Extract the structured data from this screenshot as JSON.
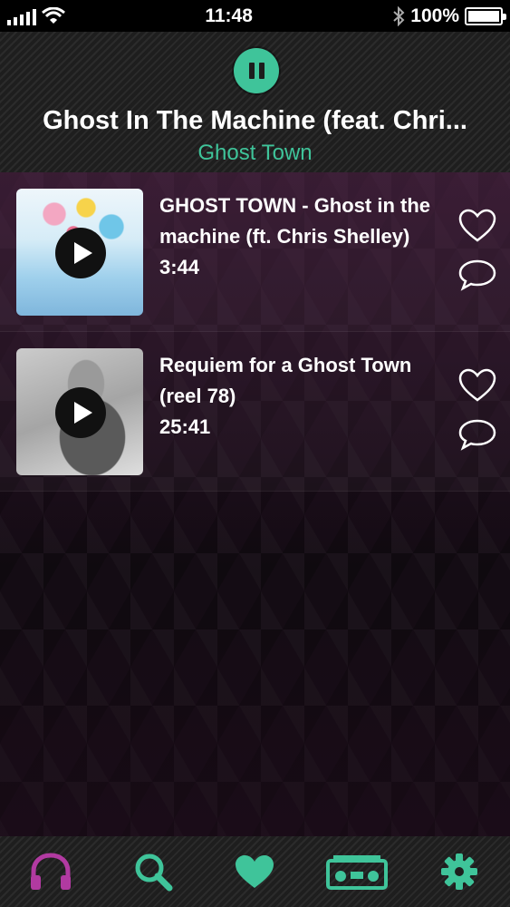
{
  "status_bar": {
    "time": "11:48",
    "battery": "100%"
  },
  "now_playing": {
    "title": "Ghost In The Machine (feat. Chri...",
    "artist": "Ghost Town",
    "state": "playing"
  },
  "tracks": [
    {
      "title": "GHOST TOWN - Ghost in the machine (ft. Chris Shelley)",
      "duration": "3:44"
    },
    {
      "title": "Requiem for a Ghost Town (reel 78)",
      "duration": "25:41"
    }
  ],
  "bottom_nav": [
    {
      "icon": "headphones-icon",
      "active": true
    },
    {
      "icon": "search-icon",
      "active": false
    },
    {
      "icon": "heart-icon",
      "active": false
    },
    {
      "icon": "radio-icon",
      "active": false
    },
    {
      "icon": "gear-icon",
      "active": false
    }
  ],
  "colors": {
    "accent": "#3fc49a",
    "active_nav": "#b13aa1"
  }
}
